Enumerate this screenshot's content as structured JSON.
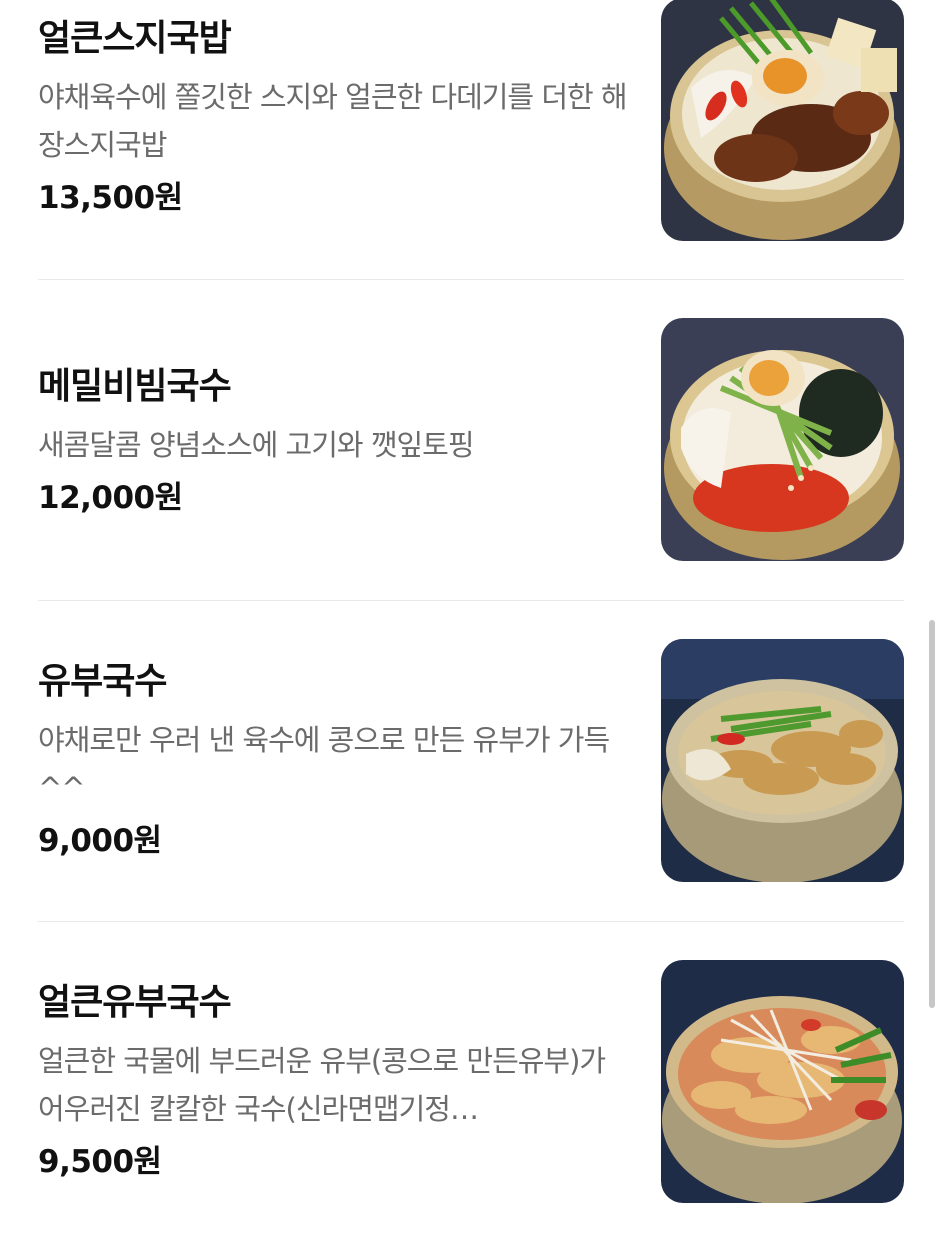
{
  "menu": {
    "items": [
      {
        "name": "얼큰스지국밥",
        "description": "야채육수에 쫄깃한 스지와 얼큰한 다데기를 더한 해장스지국밥",
        "price": "13,500원",
        "image_icon": "food-photo-icon"
      },
      {
        "name": "메밀비빔국수",
        "description": "새콤달콤 양념소스에 고기와 깻잎토핑",
        "price": "12,000원",
        "image_icon": "food-photo-icon"
      },
      {
        "name": "유부국수",
        "description": "야채로만 우러 낸 육수에 콩으로 만든 유부가 가득^^",
        "price": "9,000원",
        "image_icon": "food-photo-icon"
      },
      {
        "name": "얼큰유부국수",
        "description": "얼큰한 국물에 부드러운 유부(콩으로 만든유부)가 어우러진 칼칼한 국수(신라면맵기정…",
        "price": "9,500원",
        "image_icon": "food-photo-icon"
      }
    ]
  },
  "colors": {
    "background": "#ffffff",
    "name_text": "#111111",
    "description_text": "#6b6b6b",
    "divider": "#e9e9e9",
    "scrollbar": "#c7c7c7"
  }
}
